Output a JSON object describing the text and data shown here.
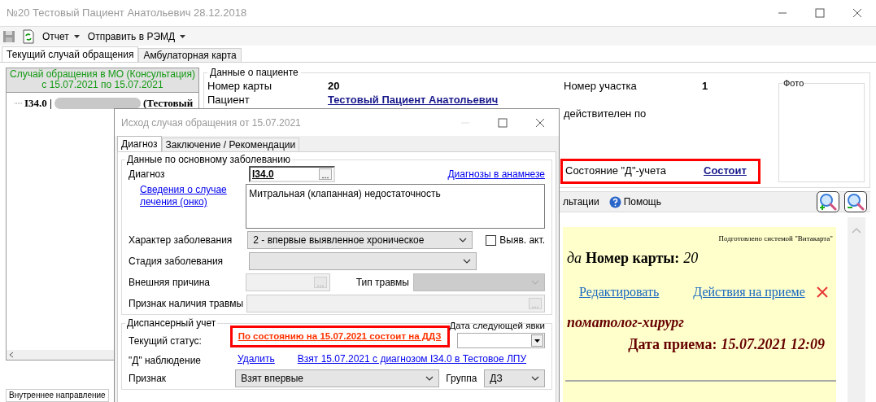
{
  "window": {
    "title": "№20 Тестовый Пациент Анатольевич 28.12.2018"
  },
  "toolbar": {
    "menus": [
      "Отчет",
      "Отправить в РЭМД"
    ]
  },
  "tabs": [
    {
      "label": "Текущий случай обращения",
      "selected": true
    },
    {
      "label": "Амбулаторная карта",
      "selected": false
    }
  ],
  "case_panel": {
    "header_lines": [
      "Случай обращения в МО (Консультация)",
      "с 15.07.2021 по 15.07.2021"
    ],
    "tree": [
      {
        "code": "I34.0 |",
        "text": "(Тестовый"
      }
    ],
    "bottom_tab": "Внутреннее направление"
  },
  "patient": {
    "title": "Данные о пациенте",
    "card_number_label": "Номер карты",
    "card_number": "20",
    "patient_label": "Пациент",
    "patient_name": "Тестовый Пациент Анатольевич",
    "district_label": "Номер участка",
    "district": "1",
    "valid_label": "действителен по",
    "d_status_label": "Состояние \"Д\"-учета",
    "d_status": "Состоит",
    "d_status_highlighted": true,
    "photo_label": "Фото"
  },
  "doc_toolbar": {
    "cut_label": "льтации",
    "help": "Помощь"
  },
  "document": {
    "prepared_by": "Подготовлено системой \"Витакарта\"",
    "line_tail": "да",
    "card_label": "Номер карты:",
    "card_number": "20",
    "links": [
      "Редактировать",
      "Действия на приеме"
    ],
    "specialty": "поматолог-хирург",
    "date_label": "Дата приема:",
    "date": "15.07.2021 12:09"
  },
  "dialog": {
    "title": "Исход случая обращения от 15.07.2021",
    "tabs": [
      {
        "label": "Диагноз",
        "selected": true
      },
      {
        "label": "Заключение / Рекомендации",
        "selected": false
      }
    ],
    "main_group": {
      "title": "Данные по основному заболеванию",
      "diagnosis_label": "Диагноз",
      "diagnosis_code": "I34.0",
      "history_link": "Диагнозы в анамнезе",
      "onco_link": "Сведения о случае лечения (онко)",
      "diagnosis_text": "Митральная (клапанная) недостаточность",
      "nature_label": "Характер заболевания",
      "nature_value": "2 - впервые выявленное хроническое",
      "revealed": {
        "label": "Выяв. акт.",
        "checked": false
      },
      "stage": {
        "label": "Стадия заболевания",
        "disabled": false
      },
      "cause": {
        "label": "Внешняя причина",
        "disabled": true
      },
      "injury_type": {
        "label": "Тип травмы",
        "disabled": true
      },
      "injury_sign": {
        "label": "Признак наличия травмы",
        "disabled": true
      }
    },
    "dispensary": {
      "title": "Диспансерный учет",
      "status_label": "Текущий статус:",
      "status": "По состоянию на 15.07.2021 состоит на ДДЗ",
      "status_highlighted": true,
      "next_visit_label": "Дата следующей явки",
      "observation_label": "\"Д\" наблюдение",
      "delete_link": "Удалить",
      "taken_link": "Взят 15.07.2021 с диагнозом I34.0 в Тестовое ЛПУ",
      "sign_label": "Признак",
      "sign_value": "Взят впервые",
      "group_label": "Группа",
      "group_value": "ДЗ"
    }
  }
}
